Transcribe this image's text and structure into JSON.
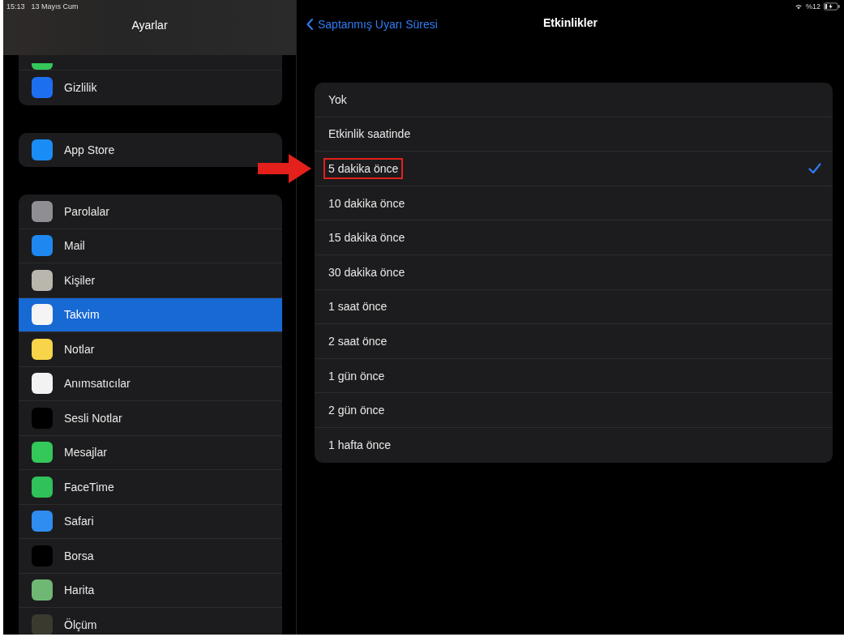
{
  "status_bar": {
    "time": "15:13",
    "date": "13 Mayıs Cum",
    "battery_text": "%12"
  },
  "sidebar": {
    "title": "Ayarlar",
    "groups": [
      {
        "items": [
          {
            "label": "Gizlilik",
            "color": "#1e6ff0",
            "selected": false
          }
        ]
      },
      {
        "items": [
          {
            "label": "App Store",
            "color": "#1a8cf5",
            "selected": false
          }
        ]
      },
      {
        "items": [
          {
            "label": "Parolalar",
            "color": "#8e8e93",
            "selected": false
          },
          {
            "label": "Mail",
            "color": "#1e88f0",
            "selected": false
          },
          {
            "label": "Kişiler",
            "color": "#b9b6ad",
            "selected": false
          },
          {
            "label": "Takvim",
            "color": "#f4f4f4",
            "selected": true
          },
          {
            "label": "Notlar",
            "color": "#f7d44a",
            "selected": false
          },
          {
            "label": "Anımsatıcılar",
            "color": "#f2f2f2",
            "selected": false
          },
          {
            "label": "Sesli Notlar",
            "color": "#000000",
            "selected": false
          },
          {
            "label": "Mesajlar",
            "color": "#34c759",
            "selected": false
          },
          {
            "label": "FaceTime",
            "color": "#30c15a",
            "selected": false
          },
          {
            "label": "Safari",
            "color": "#2f8cf0",
            "selected": false
          },
          {
            "label": "Borsa",
            "color": "#000000",
            "selected": false
          },
          {
            "label": "Harita",
            "color": "#6fb873",
            "selected": false
          },
          {
            "label": "Ölçüm",
            "color": "#3a3a30",
            "selected": false
          }
        ]
      }
    ]
  },
  "nav": {
    "back": "Saptanmış Uyarı Süresi",
    "title": "Etkinlikler"
  },
  "options": [
    {
      "label": "Yok",
      "selected": false,
      "highlighted": false
    },
    {
      "label": "Etkinlik saatinde",
      "selected": false,
      "highlighted": false
    },
    {
      "label": "5 dakika önce",
      "selected": true,
      "highlighted": true
    },
    {
      "label": "10 dakika önce",
      "selected": false,
      "highlighted": false
    },
    {
      "label": "15 dakika önce",
      "selected": false,
      "highlighted": false
    },
    {
      "label": "30 dakika önce",
      "selected": false,
      "highlighted": false
    },
    {
      "label": "1 saat önce",
      "selected": false,
      "highlighted": false
    },
    {
      "label": "2 saat önce",
      "selected": false,
      "highlighted": false
    },
    {
      "label": "1 gün önce",
      "selected": false,
      "highlighted": false
    },
    {
      "label": "2 gün önce",
      "selected": false,
      "highlighted": false
    },
    {
      "label": "1 hafta önce",
      "selected": false,
      "highlighted": false
    }
  ]
}
